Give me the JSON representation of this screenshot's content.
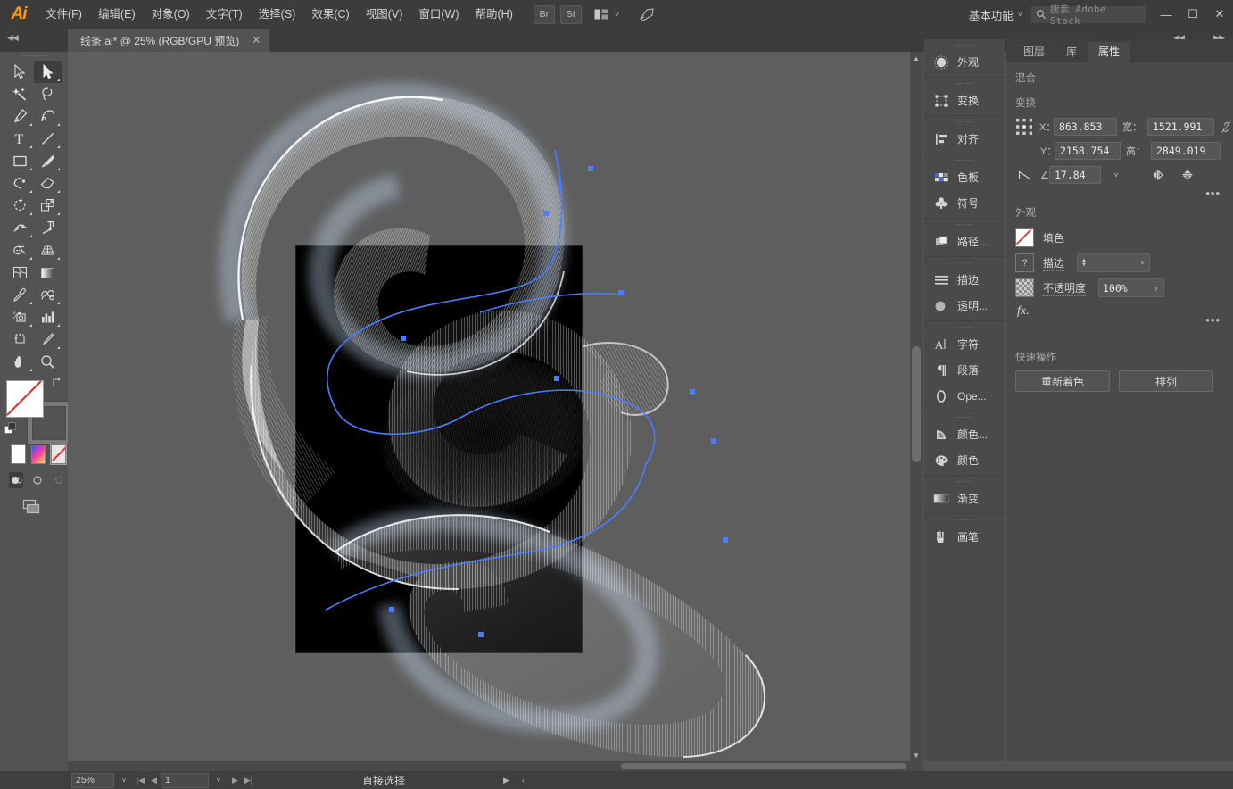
{
  "app": {
    "name": "Adobe Illustrator",
    "logo_text": "Ai",
    "accent": "#ff9a00",
    "selection_blue": "#4a7dff",
    "ui_bg": "#535353",
    "panel_bg": "#4a4a4a",
    "canvas_bg": "#5e5e5e"
  },
  "menu": {
    "items": [
      {
        "label": "文件(F)"
      },
      {
        "label": "编辑(E)"
      },
      {
        "label": "对象(O)"
      },
      {
        "label": "文字(T)"
      },
      {
        "label": "选择(S)"
      },
      {
        "label": "效果(C)"
      },
      {
        "label": "视图(V)"
      },
      {
        "label": "窗口(W)"
      },
      {
        "label": "帮助(H)"
      }
    ],
    "bridge_label": "Br",
    "stock_label": "St",
    "arrange_icon": "arrange-documents-icon",
    "rocket_icon": "rocket-icon"
  },
  "workspace": {
    "name": "基本功能",
    "chevron": "˅"
  },
  "search": {
    "placeholder": "搜索 Adobe Stock",
    "icon": "search-icon"
  },
  "window_controls": {
    "minimize": "—",
    "maximize": "☐",
    "close": "✕"
  },
  "document_tab": {
    "label": "线条.ai* @ 25% (RGB/GPU 预览)",
    "close": "✕"
  },
  "toolbar": {
    "tools": [
      {
        "name": "selection-tool",
        "label": "选择工具",
        "selected": false,
        "has_flyout": false
      },
      {
        "name": "direct-selection-tool",
        "label": "直接选择工具",
        "selected": true,
        "has_flyout": true
      },
      {
        "name": "magic-wand-tool",
        "label": "魔棒工具",
        "selected": false,
        "has_flyout": false
      },
      {
        "name": "lasso-tool",
        "label": "套索工具",
        "selected": false,
        "has_flyout": false
      },
      {
        "name": "pen-tool",
        "label": "钢笔工具",
        "selected": false,
        "has_flyout": true
      },
      {
        "name": "curvature-tool",
        "label": "曲率工具",
        "selected": false,
        "has_flyout": false
      },
      {
        "name": "type-tool",
        "label": "文字工具",
        "selected": false,
        "has_flyout": true
      },
      {
        "name": "line-segment-tool",
        "label": "直线段工具",
        "selected": false,
        "has_flyout": true
      },
      {
        "name": "rectangle-tool",
        "label": "矩形工具",
        "selected": false,
        "has_flyout": true
      },
      {
        "name": "paintbrush-tool",
        "label": "画笔工具",
        "selected": false,
        "has_flyout": true
      },
      {
        "name": "shaper-tool",
        "label": "Shaper 工具",
        "selected": false,
        "has_flyout": true
      },
      {
        "name": "eraser-tool",
        "label": "橡皮擦工具",
        "selected": false,
        "has_flyout": true
      },
      {
        "name": "rotate-tool",
        "label": "旋转工具",
        "selected": false,
        "has_flyout": true
      },
      {
        "name": "scale-tool",
        "label": "比例缩放工具",
        "selected": false,
        "has_flyout": true
      },
      {
        "name": "width-tool",
        "label": "宽度工具",
        "selected": false,
        "has_flyout": true
      },
      {
        "name": "free-transform-tool",
        "label": "自由变换工具",
        "selected": false,
        "has_flyout": false
      },
      {
        "name": "shape-builder-tool",
        "label": "形状生成器工具",
        "selected": false,
        "has_flyout": true
      },
      {
        "name": "perspective-grid-tool",
        "label": "透视网格工具",
        "selected": false,
        "has_flyout": true
      },
      {
        "name": "mesh-tool",
        "label": "网格工具",
        "selected": false,
        "has_flyout": false
      },
      {
        "name": "gradient-tool",
        "label": "渐变工具",
        "selected": false,
        "has_flyout": false
      },
      {
        "name": "eyedropper-tool",
        "label": "吸管工具",
        "selected": false,
        "has_flyout": true
      },
      {
        "name": "blend-tool",
        "label": "混合工具",
        "selected": false,
        "has_flyout": true
      },
      {
        "name": "symbol-sprayer-tool",
        "label": "符号喷枪工具",
        "selected": false,
        "has_flyout": true
      },
      {
        "name": "column-graph-tool",
        "label": "柱形图工具",
        "selected": false,
        "has_flyout": true
      },
      {
        "name": "artboard-tool",
        "label": "画板工具",
        "selected": false,
        "has_flyout": false
      },
      {
        "name": "slice-tool",
        "label": "切片工具",
        "selected": false,
        "has_flyout": true
      },
      {
        "name": "hand-tool",
        "label": "抓手工具",
        "selected": false,
        "has_flyout": true
      },
      {
        "name": "zoom-tool",
        "label": "缩放工具",
        "selected": false,
        "has_flyout": false
      }
    ],
    "fill_color": "#ffffff",
    "fill_is_none": true,
    "stroke_color": "none",
    "stroke_is_none": true,
    "color_modes": [
      {
        "name": "color-swatch-mode",
        "label": "颜色",
        "active": false
      },
      {
        "name": "gradient-mode",
        "label": "渐变",
        "active": false
      },
      {
        "name": "none-mode",
        "label": "无",
        "active": true
      }
    ],
    "draw_modes": [
      {
        "name": "draw-normal-mode",
        "label": "正常绘图",
        "active": true
      },
      {
        "name": "draw-behind-mode",
        "label": "背面绘图",
        "active": false
      },
      {
        "name": "draw-inside-mode",
        "label": "内部绘图",
        "active": false
      }
    ],
    "screen_mode": "更改屏幕模式"
  },
  "canvas": {
    "artboard_fill": "#000000",
    "zoom_level": "25%"
  },
  "dock": {
    "groups": [
      {
        "items": [
          {
            "icon": "appearance-icon",
            "label": "外观"
          }
        ]
      },
      {
        "items": [
          {
            "icon": "transform-icon",
            "label": "变换"
          }
        ]
      },
      {
        "items": [
          {
            "icon": "align-icon",
            "label": "对齐"
          }
        ]
      },
      {
        "items": [
          {
            "icon": "swatches-icon",
            "label": "色板"
          },
          {
            "icon": "symbols-icon",
            "label": "符号"
          }
        ]
      },
      {
        "items": [
          {
            "icon": "pathfinder-icon",
            "label": "路径..."
          }
        ]
      },
      {
        "items": [
          {
            "icon": "stroke-icon",
            "label": "描边"
          },
          {
            "icon": "transparency-icon",
            "label": "透明..."
          }
        ]
      },
      {
        "items": [
          {
            "icon": "character-icon",
            "label": "字符"
          },
          {
            "icon": "paragraph-icon",
            "label": "段落"
          },
          {
            "icon": "opentype-icon",
            "label": "Ope..."
          }
        ]
      },
      {
        "items": [
          {
            "icon": "color-guide-icon",
            "label": "颜色..."
          },
          {
            "icon": "color-icon",
            "label": "颜色"
          }
        ]
      },
      {
        "items": [
          {
            "icon": "gradient-icon",
            "label": "渐变"
          }
        ]
      },
      {
        "items": [
          {
            "icon": "brushes-icon",
            "label": "画笔"
          }
        ]
      }
    ]
  },
  "properties": {
    "tabs": [
      {
        "label": "图层",
        "active": false
      },
      {
        "label": "库",
        "active": false
      },
      {
        "label": "属性",
        "active": true
      }
    ],
    "blend_section_title": "混合",
    "transform": {
      "title": "变换",
      "x_label": "X：",
      "x_value": "863.853",
      "y_label": "Y：",
      "y_value": "2158.754",
      "w_label": "宽：",
      "w_value": "1521.991",
      "h_label": "高：",
      "h_value": "2849.019",
      "angle_label": "∠:",
      "angle_value": "17.84",
      "link_icon": "chain-link-broken-icon",
      "flip_h_icon": "flip-horizontal-icon",
      "flip_v_icon": "flip-vertical-icon",
      "more_icon": "more-options-icon",
      "reference_point_icon": "reference-point-grid-icon"
    },
    "appearance": {
      "title": "外观",
      "fill_label": "填色",
      "fill_swatch": "none",
      "stroke_label": "描边",
      "stroke_swatch": "unknown",
      "stroke_weight_value": "",
      "opacity_label": "不透明度",
      "opacity_value": "100%",
      "fx_label": "fx.",
      "more_icon": "more-options-icon"
    },
    "quick_actions": {
      "title": "快速操作",
      "buttons": [
        {
          "label": "重新着色",
          "name": "recolor-button"
        },
        {
          "label": "排列",
          "name": "arrange-button"
        }
      ]
    }
  },
  "statusbar": {
    "zoom_value": "25%",
    "page_value": "1",
    "tool_name": "直接选择",
    "nav_first": "|◀",
    "nav_prev": "◀",
    "nav_next": "▶",
    "nav_last": "▶|"
  }
}
